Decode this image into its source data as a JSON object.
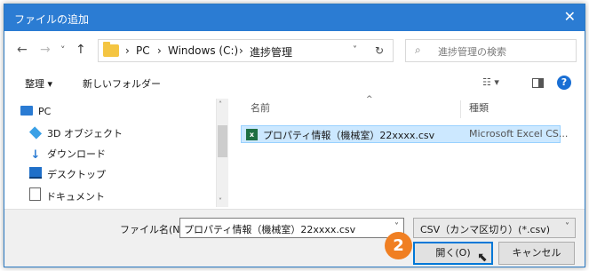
{
  "window": {
    "title": "ファイルの追加",
    "close_glyph": "✕"
  },
  "nav": {
    "back": "←",
    "forward": "→",
    "recent": "˅",
    "up": "↑",
    "breadcrumb": [
      "PC",
      "Windows (C:)",
      "進捗管理"
    ],
    "separator": "›",
    "refresh": "↻",
    "search_placeholder": "進捗管理の検索"
  },
  "commands": {
    "organize": "整理 ▾",
    "new_folder": "新しいフォルダー",
    "view_glyph": "☷ ▾"
  },
  "tree": [
    "PC",
    "3D オブジェクト",
    "ダウンロード",
    "デスクトップ",
    "ドキュメント"
  ],
  "columns": {
    "name": "名前",
    "type": "種類"
  },
  "files": [
    {
      "name": "プロパティ情報（機械室）22xxxx.csv",
      "type": "Microsoft Excel CS..."
    }
  ],
  "bottom": {
    "filename_label": "ファイル名(N):",
    "filename_value": "プロパティ情報（機械室）22xxxx.csv",
    "filter_value": "CSV（カンマ区切り）(*.csv)",
    "open_label": "開く(O)",
    "cancel_label": "キャンセル"
  },
  "step_badge": "2",
  "colors": {
    "titlebar": "#2b7cd3",
    "selection": "#cce8ff",
    "badge": "#f07f22",
    "folder": "#f4c542"
  }
}
